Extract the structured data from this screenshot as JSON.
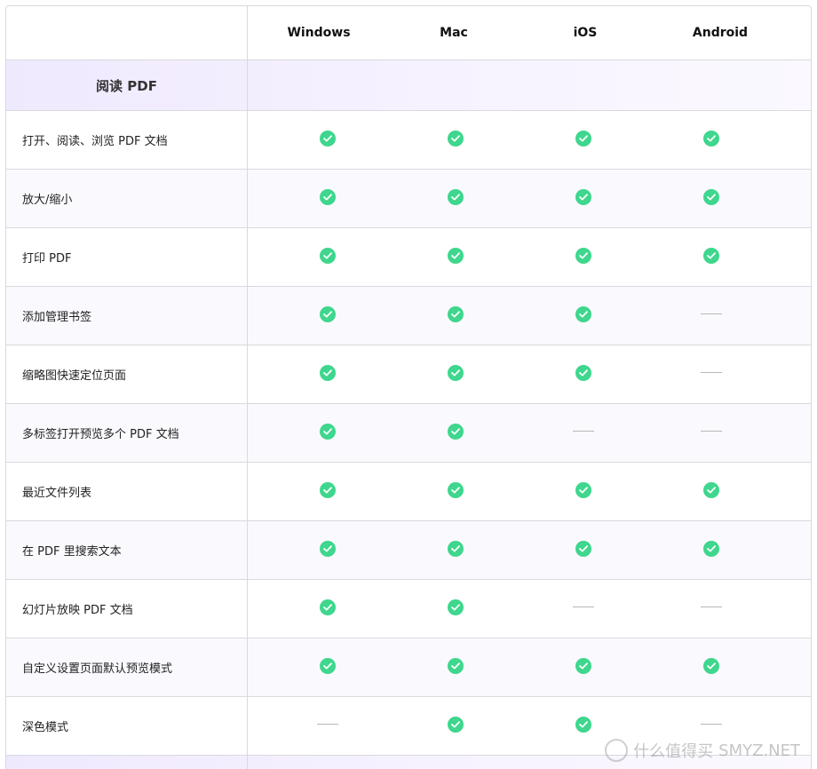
{
  "header": {
    "platforms": [
      "Windows",
      "Mac",
      "iOS",
      "Android"
    ]
  },
  "section": {
    "title": "阅读 PDF"
  },
  "rows": [
    {
      "label": "打开、阅读、浏览 PDF 文档",
      "support": [
        true,
        true,
        true,
        true
      ]
    },
    {
      "label": "放大/缩小",
      "support": [
        true,
        true,
        true,
        true
      ]
    },
    {
      "label": "打印 PDF",
      "support": [
        true,
        true,
        true,
        true
      ]
    },
    {
      "label": "添加管理书签",
      "support": [
        true,
        true,
        true,
        false
      ]
    },
    {
      "label": "缩略图快速定位页面",
      "support": [
        true,
        true,
        true,
        false
      ]
    },
    {
      "label": "多标签打开预览多个 PDF 文档",
      "support": [
        true,
        true,
        false,
        false
      ]
    },
    {
      "label": "最近文件列表",
      "support": [
        true,
        true,
        true,
        true
      ]
    },
    {
      "label": "在 PDF 里搜索文本",
      "support": [
        true,
        true,
        true,
        true
      ]
    },
    {
      "label": "幻灯片放映 PDF 文档",
      "support": [
        true,
        true,
        false,
        false
      ]
    },
    {
      "label": "自定义设置页面默认预览模式",
      "support": [
        true,
        true,
        true,
        true
      ]
    },
    {
      "label": "深色模式",
      "support": [
        false,
        true,
        true,
        false
      ]
    }
  ],
  "colors": {
    "check": "#3fd68d",
    "dash": "#b7b7b7",
    "section_bg": "#efe9fe",
    "border": "#d9d9de"
  },
  "icons": {
    "supported": "check-circle-icon",
    "unsupported": "dash-icon"
  },
  "watermark": {
    "text": "什么值得买",
    "site": "SMYZ.NET"
  }
}
